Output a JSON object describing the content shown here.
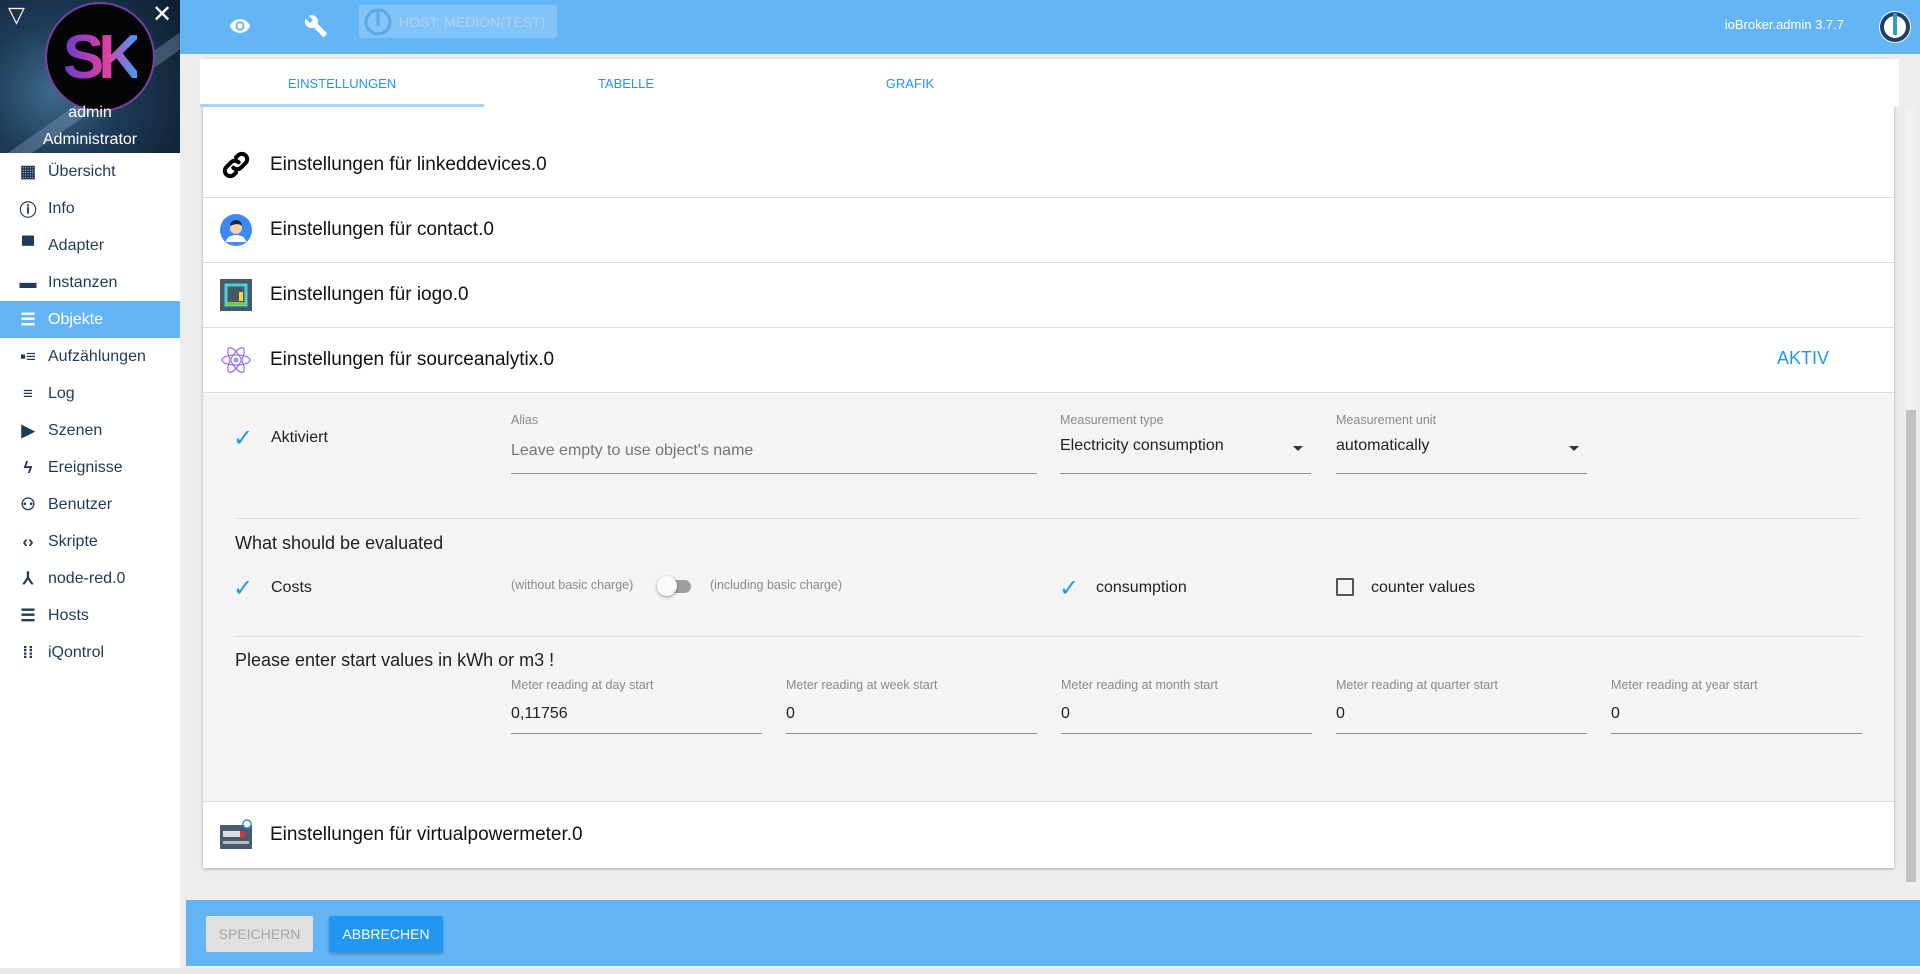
{
  "sidebar": {
    "user": {
      "name": "admin",
      "role": "Administrator",
      "logo_text": "SK"
    },
    "collapse_icon": "triangle-down-icon",
    "close_icon": "close-icon",
    "items": [
      {
        "label": "Übersicht",
        "icon": "apps-grid-icon"
      },
      {
        "label": "Info",
        "icon": "info-icon"
      },
      {
        "label": "Adapter",
        "icon": "store-icon"
      },
      {
        "label": "Instanzen",
        "icon": "subtitles-icon"
      },
      {
        "label": "Objekte",
        "icon": "list-icon",
        "active": true
      },
      {
        "label": "Aufzählungen",
        "icon": "enum-icon"
      },
      {
        "label": "Log",
        "icon": "log-icon"
      },
      {
        "label": "Szenen",
        "icon": "scenes-icon"
      },
      {
        "label": "Ereignisse",
        "icon": "flash-icon"
      },
      {
        "label": "Benutzer",
        "icon": "user-icon"
      },
      {
        "label": "Skripte",
        "icon": "code-icon"
      },
      {
        "label": "node-red.0",
        "icon": "node-red-icon"
      },
      {
        "label": "Hosts",
        "icon": "hosts-icon"
      },
      {
        "label": "iQontrol",
        "icon": "iqontrol-icon"
      }
    ]
  },
  "header": {
    "host_label": "HOST: MEDION(TEST)",
    "version": "ioBroker.admin 3.7.7",
    "colors": {
      "bar": "#64b5f6",
      "accent": "#2196f3"
    }
  },
  "tabs": [
    {
      "label": "EINSTELLUNGEN",
      "active": true
    },
    {
      "label": "TABELLE"
    },
    {
      "label": "GRAFIK"
    }
  ],
  "rows": [
    {
      "title": "Einstellungen für linkeddevices.0",
      "icon": "link-icon"
    },
    {
      "title": "Einstellungen für contact.0",
      "icon": "contact-avatar-icon"
    },
    {
      "title": "Einstellungen für iogo.0",
      "icon": "iogo-icon"
    },
    {
      "title": "Einstellungen für sourceanalytix.0",
      "icon": "atom-icon",
      "status": "AKTIV"
    }
  ],
  "last_row": {
    "title": "Einstellungen für virtualpowermeter.0",
    "icon": "power-meter-icon"
  },
  "panel": {
    "activated": {
      "label": "Aktiviert",
      "checked": true
    },
    "alias": {
      "label": "Alias",
      "placeholder": "Leave empty to use object's name",
      "value": ""
    },
    "measurement_type": {
      "label": "Measurement type",
      "value": "Electricity consumption"
    },
    "measurement_unit": {
      "label": "Measurement unit",
      "value": "automatically"
    },
    "evaluate_heading": "What should be evaluated",
    "costs": {
      "label": "Costs",
      "checked": true
    },
    "basic_charge": {
      "off_label": "(without basic charge)",
      "on_label": "(including basic charge)",
      "on": false
    },
    "consumption": {
      "label": "consumption",
      "checked": true
    },
    "counter_values": {
      "label": "counter values",
      "checked": false
    },
    "start_heading": "Please enter start values in kWh or m3 !",
    "meters": [
      {
        "label": "Meter reading at day start",
        "value": "0,11756"
      },
      {
        "label": "Meter reading at week start",
        "value": "0"
      },
      {
        "label": "Meter reading at month start",
        "value": "0"
      },
      {
        "label": "Meter reading at quarter start",
        "value": "0"
      },
      {
        "label": "Meter reading at year start",
        "value": "0"
      }
    ]
  },
  "footer": {
    "save_label": "SPEICHERN",
    "cancel_label": "ABBRECHEN"
  }
}
